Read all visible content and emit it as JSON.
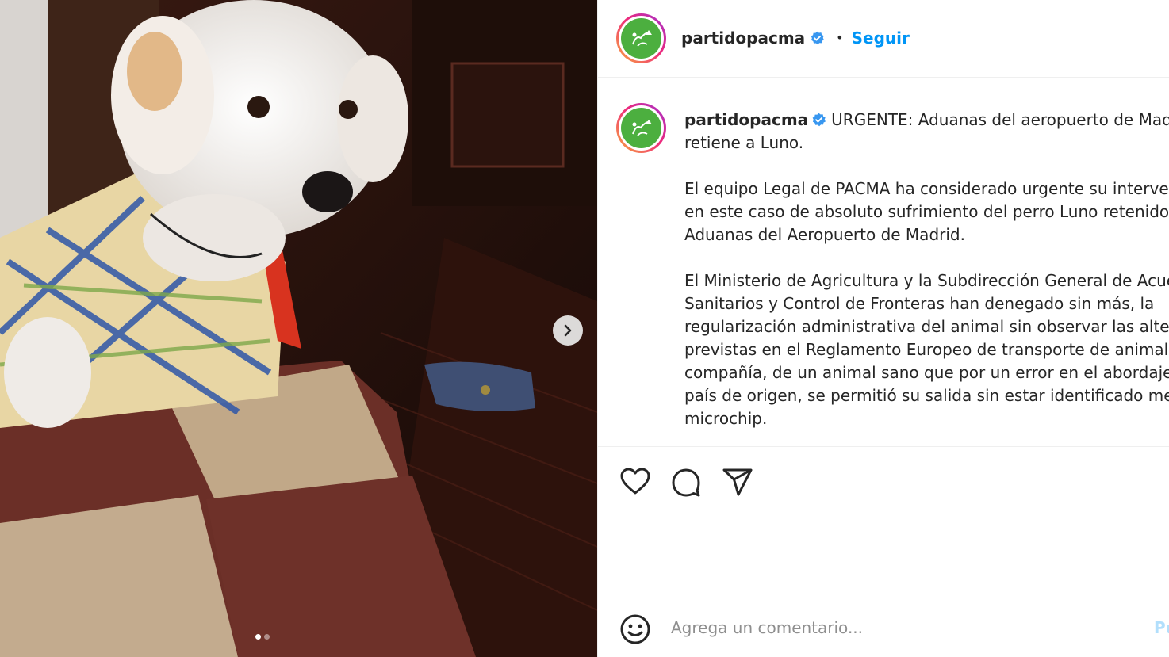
{
  "post": {
    "username": "partidopacma",
    "verified": true,
    "follow_label": "Seguir",
    "separator": "•"
  },
  "caption": {
    "username": "partidopacma",
    "line1": "URGENTE: Aduanas del aeropuerto de Madrid",
    "line2": "retiene a Luno.",
    "para2": [
      "El equipo Legal de PACMA ha considerado urgente su intervención",
      "en este caso de absoluto sufrimiento del perro Luno retenido en",
      "Aduanas del Aeropuerto de Madrid."
    ],
    "para3": [
      "El Ministerio de Agricultura y la Subdirección General de Acuerdos",
      "Sanitarios y Control de Fronteras han denegado sin más, la",
      "regularización administrativa del animal sin observar las alternativas",
      "previstas en el Reglamento Europeo de transporte de animales de",
      "compañía, de un animal sano que por un error en el abordaje en su",
      "país de origen, se permitió su salida sin estar identificado mediante",
      "microchip."
    ]
  },
  "media": {
    "total_slides": 2,
    "current_slide": 1
  },
  "actions": {
    "like": "heart-icon",
    "comment": "comment-icon",
    "share": "share-icon"
  },
  "comment_box": {
    "placeholder": "Agrega un comentario...",
    "post_label": "Publicar"
  },
  "colors": {
    "accent": "#0095f6",
    "avatar_green": "#4caf3f",
    "text": "#262626",
    "muted": "#8e8e8e"
  }
}
